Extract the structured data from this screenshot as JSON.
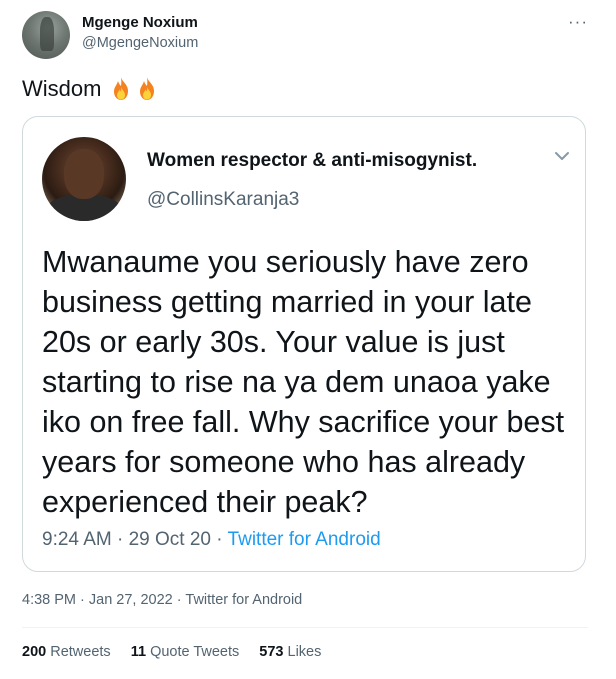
{
  "author": {
    "name": "Mgenge Noxium",
    "handle": "@MgengeNoxium"
  },
  "more_icon": "more-horizontal-icon",
  "tweet": {
    "text": "Wisdom",
    "emoji": [
      "fire-emoji",
      "fire-emoji"
    ]
  },
  "quoted": {
    "name": "Women respector & anti-misogynist.",
    "handle": "@CollinsKaranja3",
    "body": "Mwanaume you seriously have zero business getting married in your late 20s or early 30s. Your value is just starting to rise na ya dem unaoa yake iko on free fall. Why sacrifice your best years for someone who has already experienced their peak?",
    "time": "9:24 AM",
    "date": "29 Oct 20",
    "source": "Twitter for Android"
  },
  "meta": {
    "time": "4:38 PM",
    "date": "Jan 27, 2022",
    "source": "Twitter for Android"
  },
  "stats": {
    "retweets_count": "200",
    "retweets_label": "Retweets",
    "quotes_count": "11",
    "quotes_label": "Quote Tweets",
    "likes_count": "573",
    "likes_label": "Likes"
  },
  "colors": {
    "text": "#0f1419",
    "secondary": "#536471",
    "link": "#1d9bf0",
    "border": "#cfd9de"
  }
}
